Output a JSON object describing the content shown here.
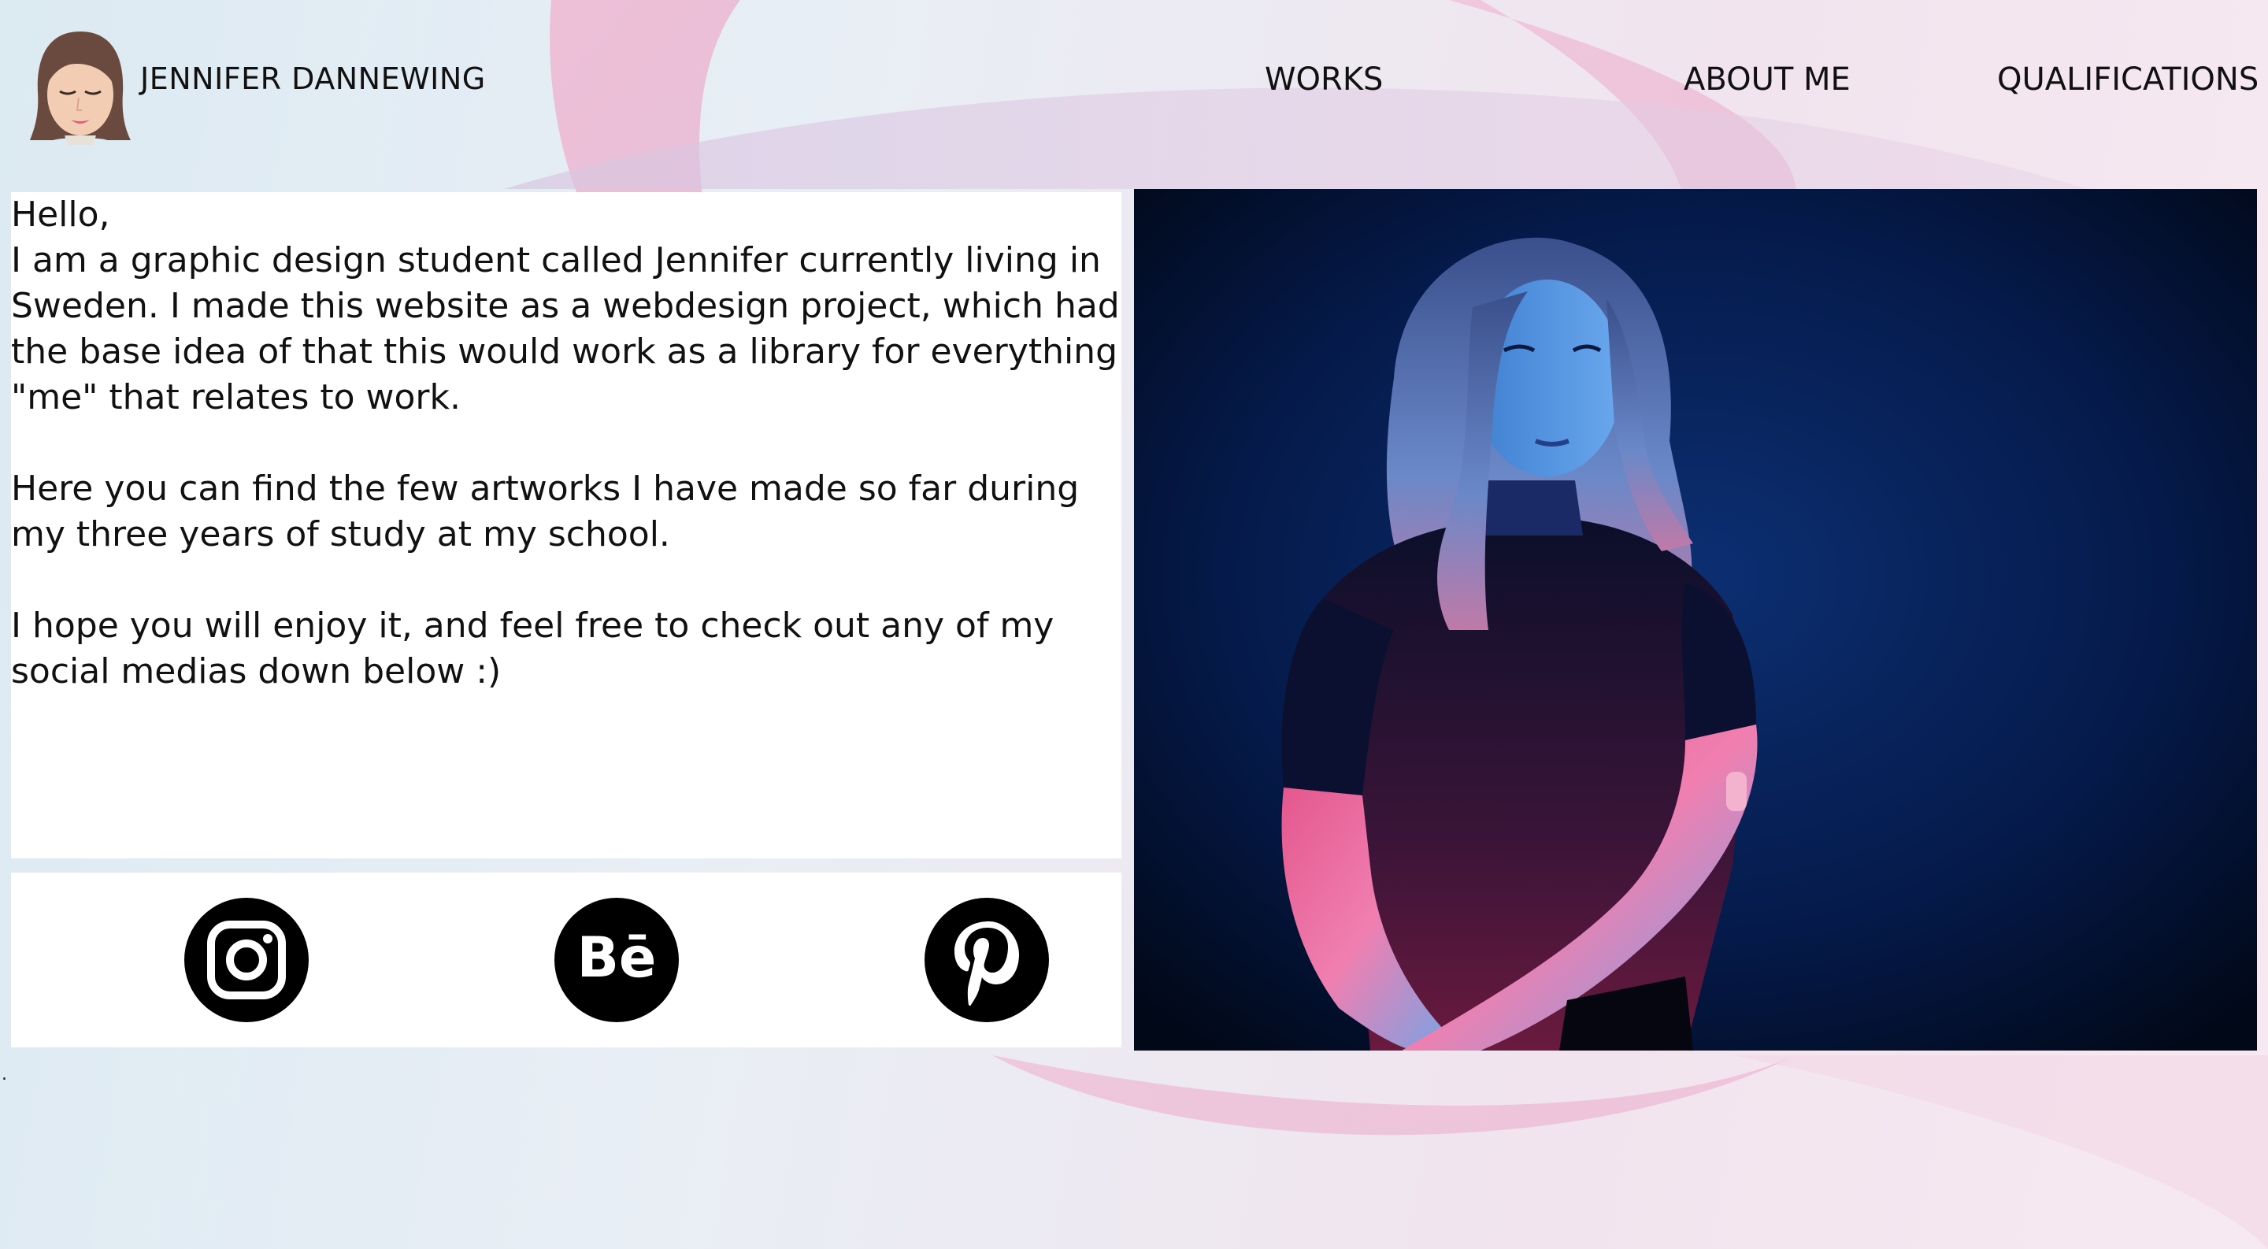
{
  "header": {
    "site_name": "JENNIFER DANNEWING",
    "nav": {
      "works": "WORKS",
      "about": "ABOUT ME",
      "qualifications": "QUALIFICATIONS"
    }
  },
  "intro": {
    "greeting": "Hello,",
    "paragraph_1": "I am a graphic design student called Jennifer currently living in Sweden. I made this website as a webdesign project, which had the base idea of that this would work as a library for everything \"me\" that relates to work.",
    "paragraph_2": "Here you can find the few artworks I have made so far during my three years of study at my school.",
    "paragraph_3": "I hope you will enjoy it, and feel free to check out any of my social medias down below :)"
  },
  "social": {
    "items": [
      {
        "icon": "instagram-icon"
      },
      {
        "icon": "behance-icon",
        "label": "Bē"
      },
      {
        "icon": "pinterest-icon"
      }
    ]
  },
  "footer": {
    "dot": "."
  },
  "colors": {
    "background_start": "#dceaf2",
    "background_end": "#f7e9f1",
    "accent_pink": "#e8a9c9",
    "panel": "#ffffff",
    "icon": "#000000"
  }
}
